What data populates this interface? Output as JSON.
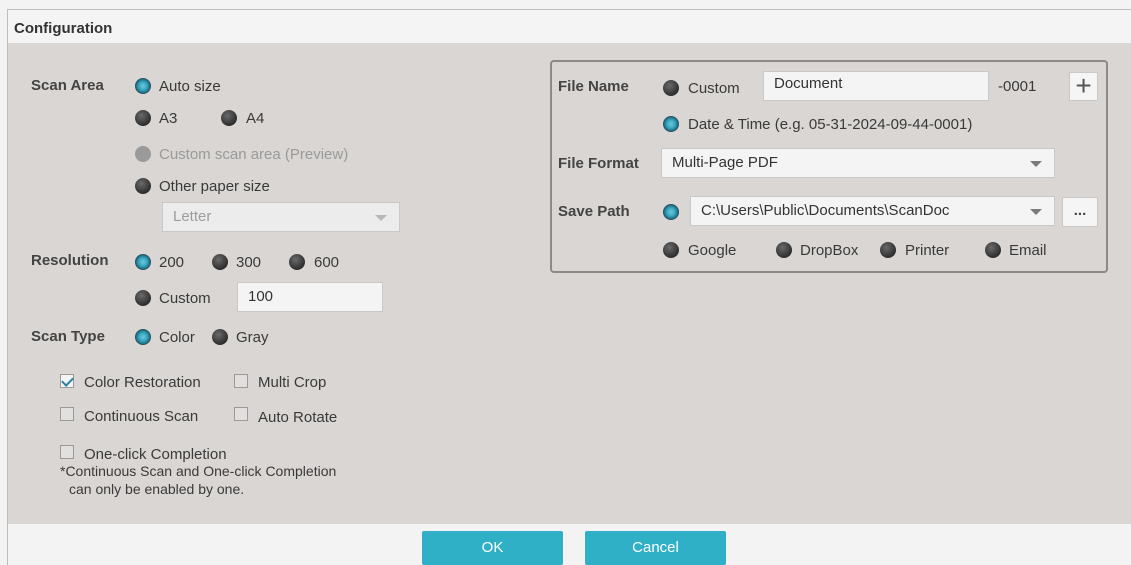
{
  "title": "Configuration",
  "scan_area": {
    "label": "Scan Area",
    "auto_size": "Auto size",
    "a3": "A3",
    "a4": "A4",
    "custom_area": "Custom scan area (Preview)",
    "other_paper": "Other paper size",
    "paper_select": "Letter"
  },
  "resolution": {
    "label": "Resolution",
    "r200": "200",
    "r300": "300",
    "r600": "600",
    "custom": "Custom",
    "custom_value": "100"
  },
  "scan_type": {
    "label": "Scan Type",
    "color": "Color",
    "gray": "Gray"
  },
  "options": {
    "color_restoration": "Color Restoration",
    "multi_crop": "Multi Crop",
    "continuous_scan": "Continuous Scan",
    "auto_rotate": "Auto Rotate",
    "one_click": "One-click Completion",
    "note_line1": "*Continuous Scan and One-click Completion",
    "note_line2": "can only be enabled by one."
  },
  "file_name": {
    "label": "File Name",
    "custom": "Custom",
    "custom_value": "Document",
    "suffix": "-0001",
    "plus_icon": "+",
    "date_time": "Date & Time (e.g. 05-31-2024-09-44-0001)"
  },
  "file_format": {
    "label": "File Format",
    "value": "Multi-Page PDF"
  },
  "save_path": {
    "label": "Save Path",
    "value": "C:\\Users\\Public\\Documents\\ScanDoc",
    "browse": "...",
    "google": "Google",
    "dropbox": "DropBox",
    "printer": "Printer",
    "email": "Email"
  },
  "buttons": {
    "ok": "OK",
    "cancel": "Cancel"
  },
  "colors": {
    "accent": "#2fb0c6",
    "panel_bg": "#d9d6d3",
    "radio_selected": "#3aa8c2"
  }
}
